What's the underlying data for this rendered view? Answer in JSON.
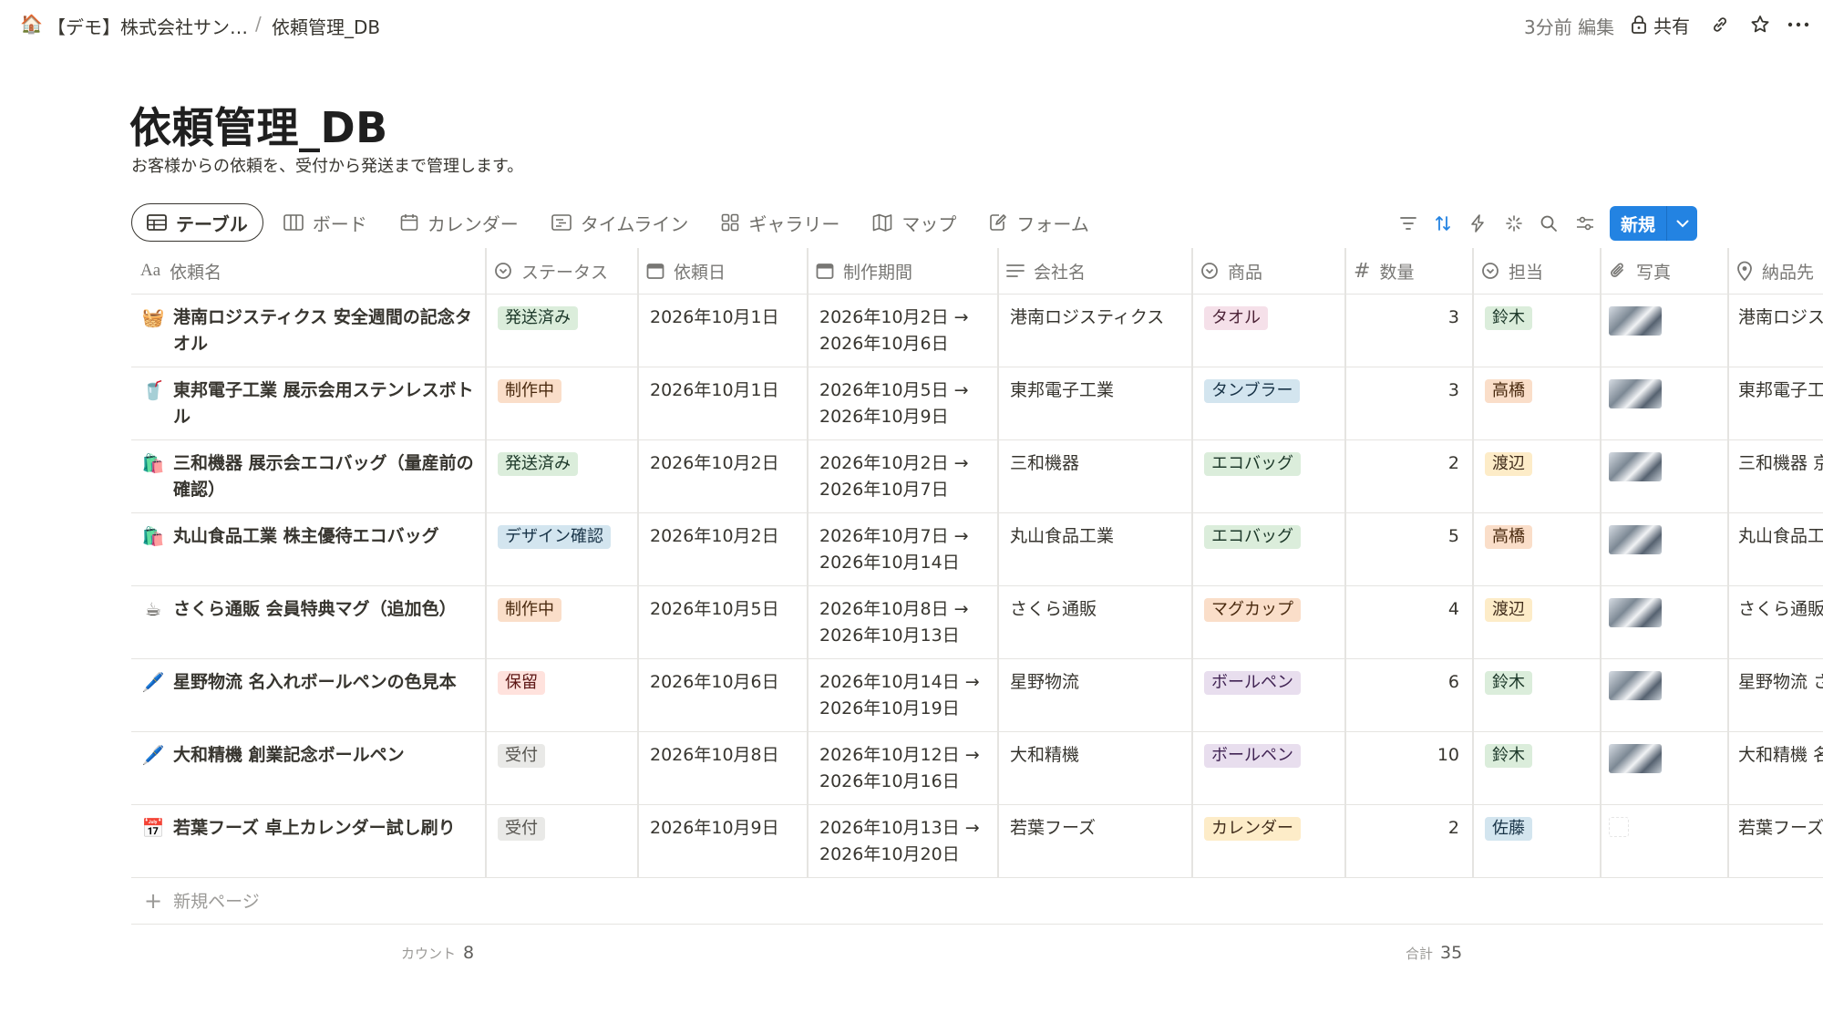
{
  "breadcrumb": {
    "workspace_icon": "house-icon",
    "workspace": "【デモ】株式会社サン…",
    "separator": "/",
    "page": "依頼管理_DB"
  },
  "topbar": {
    "edited": "3分前 編集",
    "share": "共有",
    "icons": [
      "lock-icon",
      "link-icon",
      "star-icon",
      "more-icon"
    ]
  },
  "page": {
    "title": "依頼管理_DB",
    "description": "お客様からの依頼を、受付から発送まで管理します。"
  },
  "views": [
    {
      "label": "テーブル",
      "icon": "table-icon",
      "active": true
    },
    {
      "label": "ボード",
      "icon": "board-icon"
    },
    {
      "label": "カレンダー",
      "icon": "calendar-icon"
    },
    {
      "label": "タイムライン",
      "icon": "timeline-icon"
    },
    {
      "label": "ギャラリー",
      "icon": "gallery-icon"
    },
    {
      "label": "マップ",
      "icon": "map-icon"
    },
    {
      "label": "フォーム",
      "icon": "form-icon"
    }
  ],
  "toolbar": {
    "icons": [
      "filter-icon",
      "sort-icon",
      "automation-icon",
      "ai-icon",
      "search-icon",
      "settings-icon"
    ],
    "new_label": "新規"
  },
  "columns": [
    {
      "label": "依頼名",
      "icon": "title-icon"
    },
    {
      "label": "ステータス",
      "icon": "status-icon"
    },
    {
      "label": "依頼日",
      "icon": "date-icon"
    },
    {
      "label": "制作期間",
      "icon": "date-icon"
    },
    {
      "label": "会社名",
      "icon": "text-icon"
    },
    {
      "label": "商品",
      "icon": "select-icon"
    },
    {
      "label": "数量",
      "icon": "number-icon"
    },
    {
      "label": "担当",
      "icon": "select-icon"
    },
    {
      "label": "写真",
      "icon": "attachment-icon"
    },
    {
      "label": "納品先",
      "icon": "location-icon"
    }
  ],
  "rows": [
    {
      "emoji": "🧺",
      "name": "港南ロジスティクス 安全週間の記念タオル",
      "status": "発送済み",
      "date": "2026年10月1日",
      "period_start": "2026年10月2日 →",
      "period_end": "2026年10月6日",
      "company": "港南ロジスティクス",
      "product": "タオル",
      "qty": "3",
      "owner": "鈴木",
      "photo": true,
      "dest": "港南ロジスンター"
    },
    {
      "emoji": "🥤",
      "name": "東邦電子工業 展示会用ステンレスボトル",
      "status": "制作中",
      "date": "2026年10月1日",
      "period_start": "2026年10月5日 →",
      "period_end": "2026年10月9日",
      "company": "東邦電子工業",
      "product": "タンブラー",
      "qty": "3",
      "owner": "高橋",
      "photo": true,
      "dest": "東邦電子工"
    },
    {
      "emoji": "🛍️",
      "name": "三和機器 展示会エコバッグ（量産前の確認）",
      "status": "発送済み",
      "date": "2026年10月2日",
      "period_start": "2026年10月2日 →",
      "period_end": "2026年10月7日",
      "company": "三和機器",
      "product": "エコバッグ",
      "qty": "2",
      "owner": "渡辺",
      "photo": true,
      "dest": "三和機器 京"
    },
    {
      "emoji": "🛍️",
      "name": "丸山食品工業 株主優待エコバッグ",
      "status": "デザイン確認",
      "date": "2026年10月2日",
      "period_start": "2026年10月7日 →",
      "period_end": "2026年10月14日",
      "company": "丸山食品工業",
      "product": "エコバッグ",
      "qty": "5",
      "owner": "高橋",
      "photo": true,
      "dest": "丸山食品工"
    },
    {
      "emoji": "☕",
      "name": "さくら通販 会員特典マグ（追加色）",
      "status": "制作中",
      "date": "2026年10月5日",
      "period_start": "2026年10月8日 →",
      "period_end": "2026年10月13日",
      "company": "さくら通販",
      "product": "マグカップ",
      "qty": "4",
      "owner": "渡辺",
      "photo": true,
      "dest": "さくら通販"
    },
    {
      "emoji": "🖊️",
      "name": "星野物流 名入れボールペンの色見本",
      "status": "保留",
      "date": "2026年10月6日",
      "period_start": "2026年10月14日 →",
      "period_end": "2026年10月19日",
      "company": "星野物流",
      "product": "ボールペン",
      "qty": "6",
      "owner": "鈴木",
      "photo": true,
      "dest": "星野物流 さ"
    },
    {
      "emoji": "🖊️",
      "name": "大和精機 創業記念ボールペン",
      "status": "受付",
      "date": "2026年10月8日",
      "period_start": "2026年10月12日 →",
      "period_end": "2026年10月16日",
      "company": "大和精機",
      "product": "ボールペン",
      "qty": "10",
      "owner": "鈴木",
      "photo": true,
      "dest": "大和精機 名"
    },
    {
      "emoji": "📅",
      "name": "若葉フーズ 卓上カレンダー試し刷り",
      "status": "受付",
      "date": "2026年10月9日",
      "period_start": "2026年10月13日 →",
      "period_end": "2026年10月20日",
      "company": "若葉フーズ",
      "product": "カレンダー",
      "qty": "2",
      "owner": "佐藤",
      "photo": false,
      "dest": "若葉フーズ"
    }
  ],
  "new_page_label": "新規ページ",
  "footer": {
    "count_label": "カウント",
    "count_value": "8",
    "sum_label": "合計",
    "sum_value": "35"
  },
  "tag_colors": {
    "発送済み": {
      "bg": "#dbeddb",
      "fg": "#1c3829"
    },
    "制作中": {
      "bg": "#fadec9",
      "fg": "#49290e"
    },
    "デザイン確認": {
      "bg": "#d3e5ef",
      "fg": "#183347"
    },
    "保留": {
      "bg": "#ffe2dd",
      "fg": "#5d1715"
    },
    "受付": {
      "bg": "#e9e9e7",
      "fg": "#55534e"
    },
    "タオル": {
      "bg": "#f5e0e9",
      "fg": "#4c2337"
    },
    "タンブラー": {
      "bg": "#d3e5ef",
      "fg": "#183347"
    },
    "エコバッグ": {
      "bg": "#dbeddb",
      "fg": "#1c3829"
    },
    "マグカップ": {
      "bg": "#fadec9",
      "fg": "#49290e"
    },
    "ボールペン": {
      "bg": "#e8deee",
      "fg": "#412454"
    },
    "カレンダー": {
      "bg": "#fdecc8",
      "fg": "#402c1b"
    },
    "鈴木": {
      "bg": "#dbeddb",
      "fg": "#1c3829"
    },
    "高橋": {
      "bg": "#fadec9",
      "fg": "#49290e"
    },
    "渡辺": {
      "bg": "#fdecc8",
      "fg": "#402c1b"
    },
    "佐藤": {
      "bg": "#d3e5ef",
      "fg": "#183347"
    }
  },
  "accent": "#2383e2"
}
